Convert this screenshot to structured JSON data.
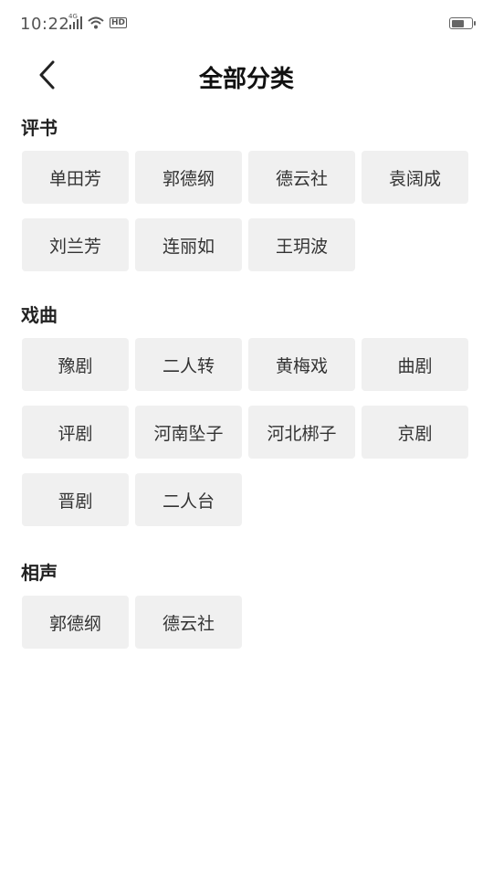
{
  "status_bar": {
    "time": "10:22",
    "signal_label": "4G",
    "hd_label": "HD",
    "icons": [
      "signal-icon",
      "wifi-icon",
      "hd-icon",
      "battery-icon"
    ],
    "battery_level": 0.65
  },
  "header": {
    "title": "全部分类",
    "back_icon": "chevron-left-icon"
  },
  "sections": [
    {
      "title": "评书",
      "items": [
        "单田芳",
        "郭德纲",
        "德云社",
        "袁阔成",
        "刘兰芳",
        "连丽如",
        "王玥波"
      ]
    },
    {
      "title": "戏曲",
      "items": [
        "豫剧",
        "二人转",
        "黄梅戏",
        "曲剧",
        "评剧",
        "河南坠子",
        "河北梆子",
        "京剧",
        "晋剧",
        "二人台"
      ]
    },
    {
      "title": "相声",
      "items": [
        "郭德纲",
        "德云社"
      ]
    }
  ],
  "colors": {
    "chip_bg": "#f0f0f0",
    "text": "#222222",
    "background": "#ffffff"
  }
}
